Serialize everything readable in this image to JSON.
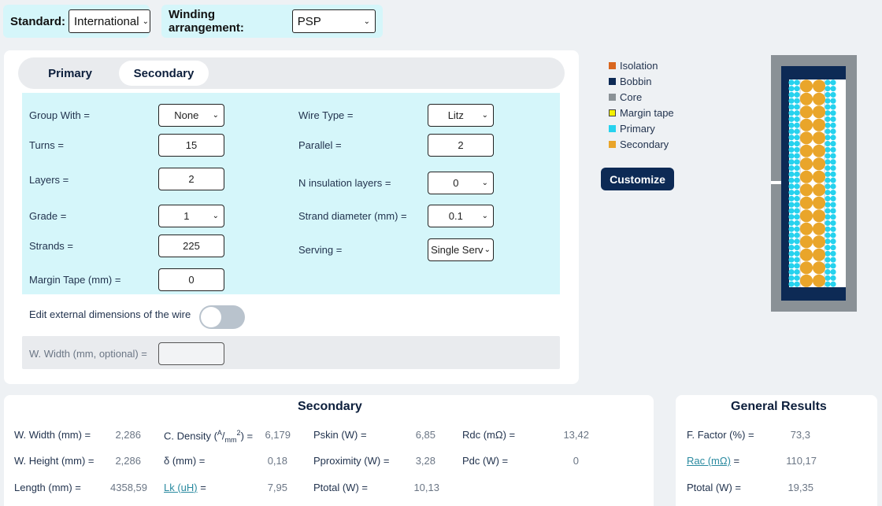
{
  "top": {
    "standard_label": "Standard:",
    "standard_value": "International",
    "winding_label": "Winding arrangement:",
    "winding_value": "PSP"
  },
  "tabs": [
    {
      "label": "Primary",
      "active": false
    },
    {
      "label": "Secondary",
      "active": true
    }
  ],
  "form": {
    "group_with": {
      "label": "Group With =",
      "value": "None"
    },
    "turns": {
      "label": "Turns =",
      "value": "15"
    },
    "layers": {
      "label": "Layers =",
      "value": "2"
    },
    "grade": {
      "label": "Grade =",
      "value": "1"
    },
    "strands": {
      "label": "Strands =",
      "value": "225"
    },
    "margin_tape": {
      "label": "Margin Tape (mm) =",
      "value": "0"
    },
    "wire_type": {
      "label": "Wire Type =",
      "value": "Litz"
    },
    "parallel": {
      "label": "Parallel =",
      "value": "2"
    },
    "n_insulation": {
      "label": "N insulation layers =",
      "value": "0"
    },
    "strand_diameter": {
      "label": "Strand diameter (mm) =",
      "value": "0.1"
    },
    "serving": {
      "label": "Serving =",
      "value": "Single Serv"
    }
  },
  "toggle": {
    "label": "Edit external dimensions of the wire",
    "on": false
  },
  "optional": {
    "label": "W. Width (mm, optional) =",
    "value": ""
  },
  "legend": [
    {
      "label": "Isolation",
      "color": "#d9661f"
    },
    {
      "label": "Bobbin",
      "color": "#0d2a55"
    },
    {
      "label": "Core",
      "color": "#8a9196"
    },
    {
      "label": "Margin tape",
      "color": "#f4f000"
    },
    {
      "label": "Primary",
      "color": "#26d2ee"
    },
    {
      "label": "Secondary",
      "color": "#e9a52a"
    }
  ],
  "customize_label": "Customize",
  "secondary_results": {
    "title": "Secondary",
    "w_width": {
      "label": "W. Width (mm) =",
      "value": "2,286"
    },
    "w_height": {
      "label": "W. Height (mm) =",
      "value": "2,286"
    },
    "length": {
      "label": "Length (mm) =",
      "value": "4358,59"
    },
    "c_density": {
      "label_prefix": "C. Density (",
      "sup1": "A",
      "slash": "/",
      "sub": "mm",
      "sup2": "2",
      "label_suffix": ") =",
      "value": "6,179"
    },
    "delta": {
      "label": "δ (mm) =",
      "value": "0,18"
    },
    "lk": {
      "label": "Lk (uH)",
      "eq": " =",
      "value": "7,95"
    },
    "pskin": {
      "label": "Pskin (W) =",
      "value": "6,85"
    },
    "pproximity": {
      "label": "Pproximity (W) =",
      "value": "3,28"
    },
    "ptotal": {
      "label": "Ptotal (W) =",
      "value": "10,13"
    },
    "rdc": {
      "label": "Rdc (mΩ) =",
      "value": "13,42"
    },
    "pdc": {
      "label": "Pdc (W) =",
      "value": "0"
    }
  },
  "general_results": {
    "title": "General Results",
    "f_factor": {
      "label": "F. Factor (%) =",
      "value": "73,3"
    },
    "rac": {
      "label": "Rac (mΩ)",
      "eq": " =",
      "value": "110,17"
    },
    "ptotal": {
      "label": "Ptotal (W) =",
      "value": "19,35"
    }
  },
  "winding_visual": {
    "primary_rows": 34,
    "secondary_rows": 16,
    "primary_columns_each_side": 2,
    "secondary_columns": 2
  }
}
